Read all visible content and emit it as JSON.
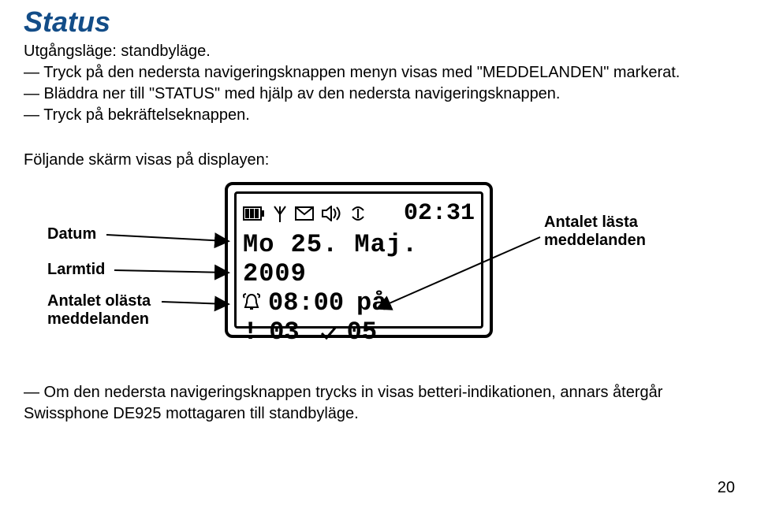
{
  "heading": "Status",
  "intro": "Utgångsläge: standbyläge.",
  "bullets_a": [
    "— Tryck på den nedersta navigeringsknappen menyn visas med \"MEDDELANDEN\" markerat.",
    "— Bläddra ner till \"STATUS\" med hjälp av den nedersta navigeringsknappen.",
    "— Tryck på bekräftelseknappen."
  ],
  "lead": "Följande skärm visas på displayen:",
  "labels": {
    "date": "Datum",
    "alarm": "Larmtid",
    "unread_label_line1": "Antalet olästa",
    "unread_label_line2": "meddelanden",
    "read_label_line1": "Antalet lästa",
    "read_label_line2": "meddelanden"
  },
  "lcd": {
    "time": "02:31",
    "date": "Mo 25. Maj. 2009",
    "alarm_time": "08:00",
    "alarm_suffix": "på",
    "unread": "03",
    "read": "05"
  },
  "bullets_b": [
    "— Om den nedersta navigeringsknappen trycks in visas betteri-indikationen, annars återgår Swissphone DE925 mottagaren till standbyläge."
  ],
  "page_number": "20"
}
